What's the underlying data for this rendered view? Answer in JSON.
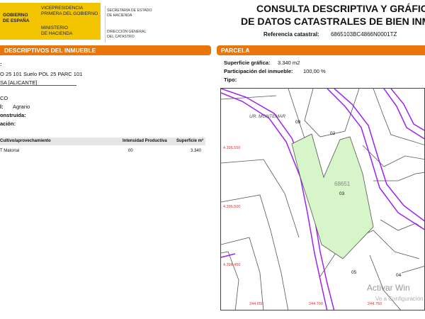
{
  "header": {
    "logo": {
      "gov": "GOBIERNO\nDE ESPAÑA",
      "vice": "VICEPRESIDENCIA\nPRIMERA DEL GOBIERNO",
      "min": "MINISTERIO\nDE HACIENDA",
      "sec": "SECRETARÍA DE ESTADO\nDE HACIENDA",
      "dir": "DIRECCIÓN GENERAL\nDEL CATASTRO"
    },
    "title_line1": "CONSULTA DESCRIPTIVA Y GRÁFICA",
    "title_line2": "DE DATOS CATASTRALES DE BIEN INMUE",
    "ref_label": "Referencia catastral:",
    "ref_value": "6865103BC4866N0001TZ"
  },
  "left": {
    "section_title": "DESCRIPTIVOS DEL INMUEBLE",
    "colon_line": ":",
    "location_line1": "O 25 101 Suelo POL 25 PARC 101",
    "location_line2": "SA [ALICANTE]",
    "clase": "CO",
    "uso_label": "l:",
    "uso_value": "Agrario",
    "construida_label": "onstruida:",
    "construccion_label": "ación:",
    "cultivos": {
      "headers": [
        "Cultivo/aprovechamiento",
        "Intensidad Productiva",
        "Superficie m²"
      ],
      "rows": [
        [
          "T Matorral",
          "00",
          "3.340"
        ]
      ]
    }
  },
  "right": {
    "section_title": "PARCELA",
    "sup_label": "Superficie gráfica:",
    "sup_value": "3.340 m2",
    "part_label": "Participación del inmueble:",
    "part_value": "100,00 %",
    "tipo_label": "Tipo:"
  },
  "map": {
    "area_name": "UR. MONTEMAR",
    "parcel_ref": "68651",
    "parcel_num": "03",
    "labels": [
      "09",
      "02",
      "05",
      "04"
    ],
    "y_coords": [
      "4.396.550",
      "4.396.500",
      "4.396.450"
    ],
    "x_coords": [
      "244.650",
      "244.700",
      "244.750"
    ],
    "colors": {
      "parcel_fill": "#d6f5c8",
      "road": "#a020f0",
      "coord": "#e03030"
    }
  },
  "watermark": {
    "line1": "Activar Win",
    "line2": "Ve a Configuración"
  }
}
